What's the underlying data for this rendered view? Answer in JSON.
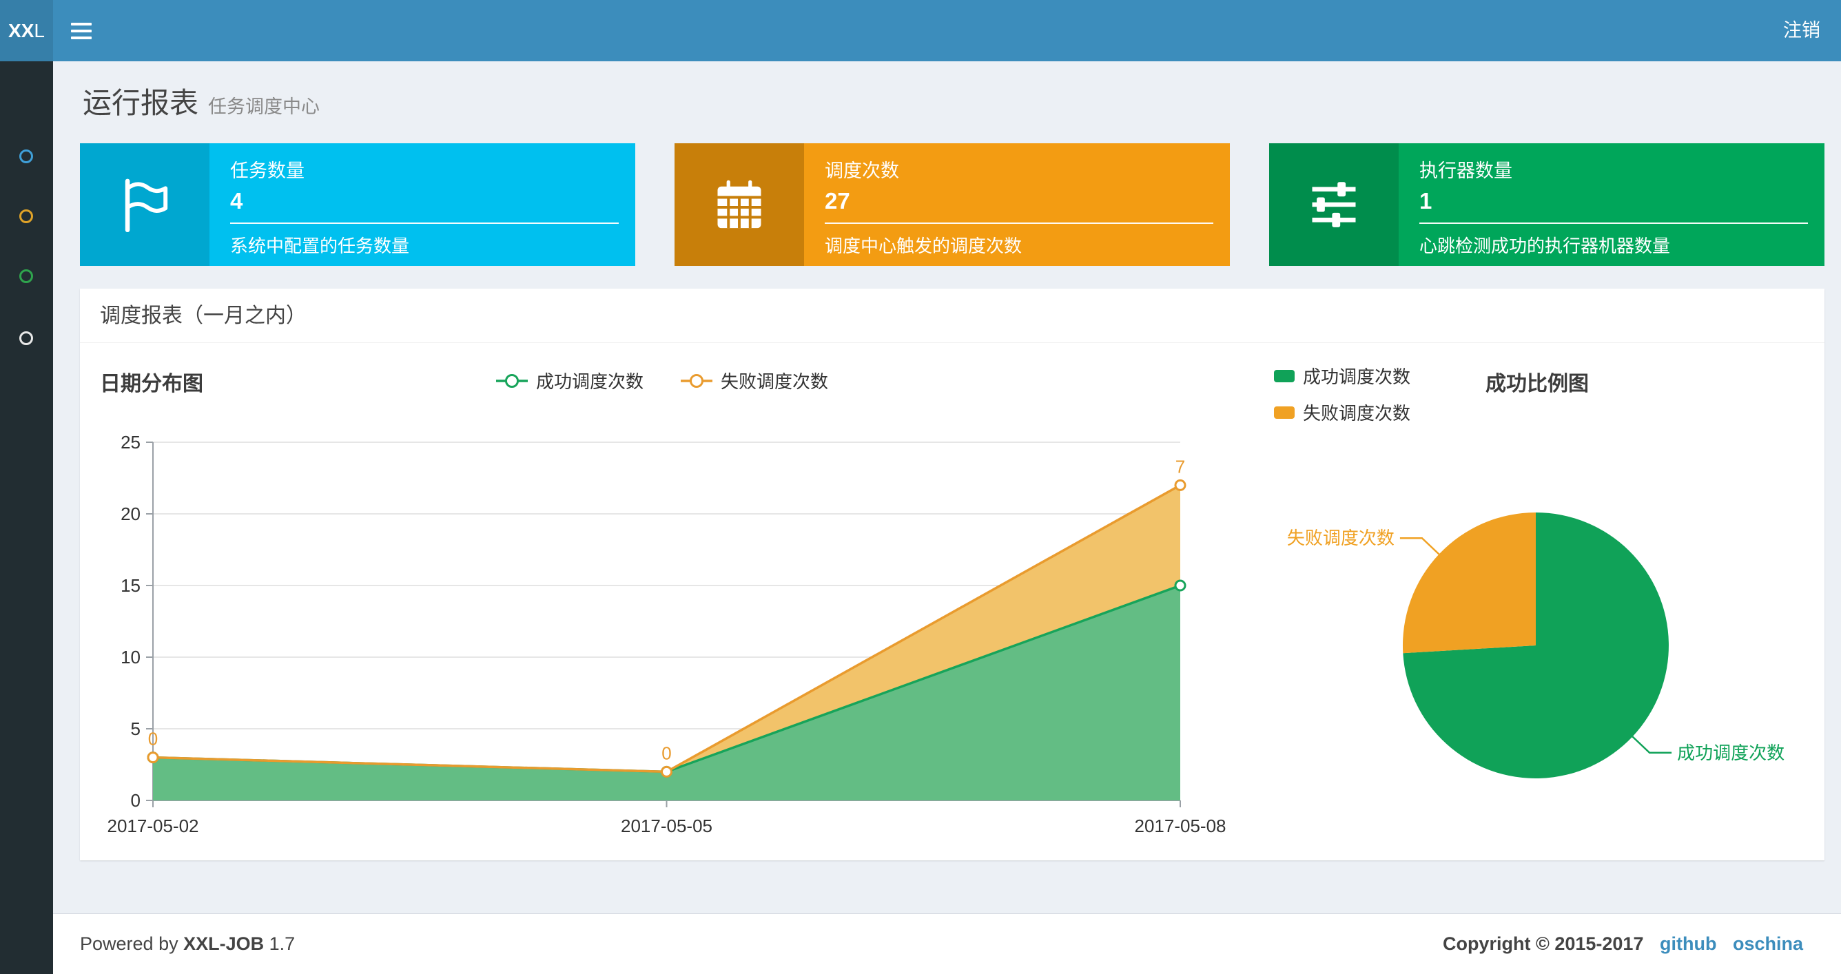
{
  "theme": {
    "navbar": "#3c8dbc",
    "navbar_logo": "#367fa9",
    "sidebar": "#222d32",
    "content_bg": "#ecf0f5",
    "link": "#3c8dbc"
  },
  "navbar": {
    "logo_bold": "XX",
    "logo_light": "L",
    "logout_label": "注销"
  },
  "sidebar": {
    "items": [
      {
        "name": "menu-item-1",
        "color": "#3f9fd8"
      },
      {
        "name": "menu-item-2",
        "color": "#dfa228"
      },
      {
        "name": "menu-item-3",
        "color": "#2fa44d"
      },
      {
        "name": "menu-item-4",
        "color": "#e8e8e8"
      }
    ]
  },
  "page_header": {
    "title": "运行报表",
    "subtitle": "任务调度中心"
  },
  "info_boxes": [
    {
      "label": "任务数量",
      "value": "4",
      "desc": "系统中配置的任务数量",
      "color": "#00c0ef",
      "icon_bg": "#00a7d0",
      "icon": "flag-icon"
    },
    {
      "label": "调度次数",
      "value": "27",
      "desc": "调度中心触发的调度次数",
      "color": "#f39c12",
      "icon_bg": "#c87f0a",
      "icon": "calendar-icon"
    },
    {
      "label": "执行器数量",
      "value": "1",
      "desc": "心跳检测成功的执行器机器数量",
      "color": "#00a65a",
      "icon_bg": "#008d4c",
      "icon": "sliders-icon"
    }
  ],
  "panel": {
    "title": "调度报表（一月之内）"
  },
  "chart_data": [
    {
      "type": "area",
      "title": "日期分布图",
      "x": [
        "2017-05-02",
        "2017-05-05",
        "2017-05-08"
      ],
      "series": [
        {
          "name": "成功调度次数",
          "values": [
            3,
            2,
            15
          ],
          "color": "#17a45a",
          "area": "#63bd84"
        },
        {
          "name": "失败调度次数",
          "values": [
            0,
            0,
            7
          ],
          "color": "#e99b2e",
          "area": "#f2c36a",
          "stack": true
        }
      ],
      "ylim": [
        0,
        25
      ],
      "yticks": [
        0,
        5,
        10,
        15,
        20,
        25
      ],
      "legend_position": "top",
      "grid": true
    },
    {
      "type": "pie",
      "title": "成功比例图",
      "slices": [
        {
          "name": "成功调度次数",
          "value": 20,
          "color": "#10a258"
        },
        {
          "name": "失败调度次数",
          "value": 7,
          "color": "#f0a123"
        }
      ],
      "legend_position": "top-left"
    }
  ],
  "footer": {
    "powered_prefix": "Powered by",
    "product": "XXL-JOB",
    "version": "1.7",
    "copyright": "Copyright © 2015-2017",
    "links": [
      {
        "label": "github"
      },
      {
        "label": "oschina"
      }
    ]
  }
}
